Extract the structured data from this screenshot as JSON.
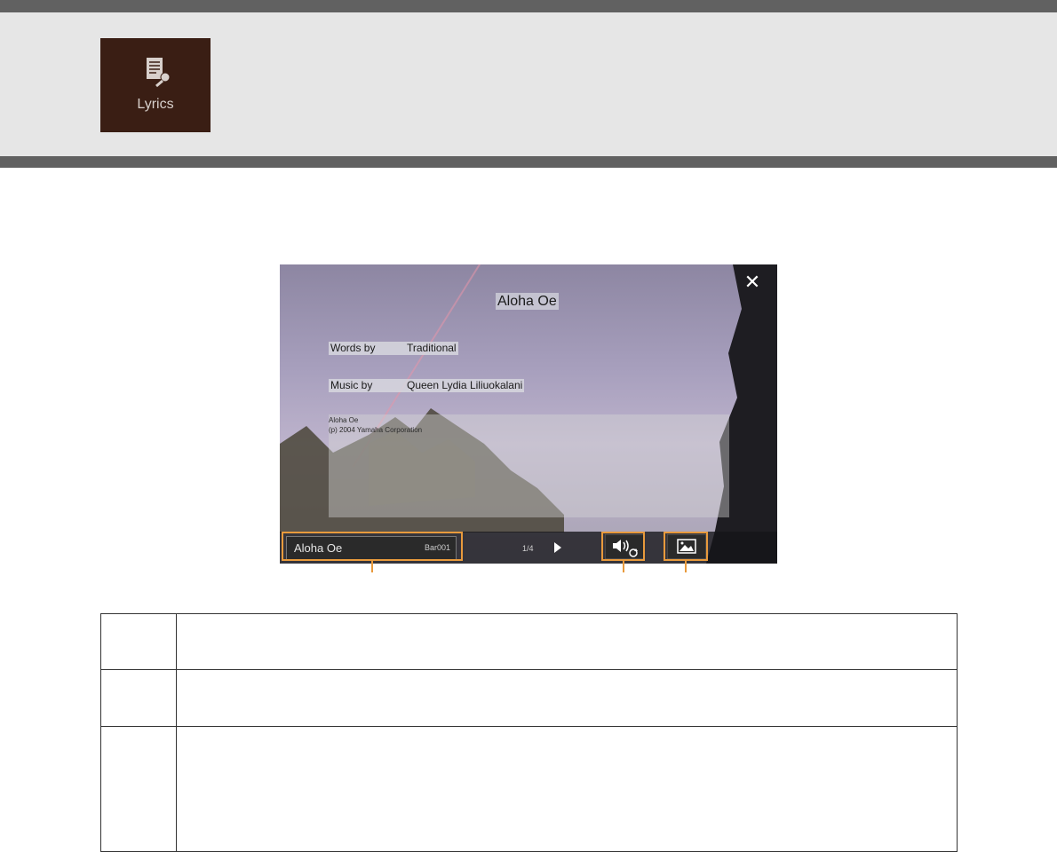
{
  "header": {
    "tile": {
      "label": "Lyrics",
      "icon": "lyrics-microphone-icon",
      "background": "#3a1e14"
    },
    "band_color": "#e6e6e6",
    "rule_color": "#616161"
  },
  "lyrics_screen": {
    "song_title": "Aloha Oe",
    "credits": [
      {
        "label": "Words by",
        "value": "Traditional"
      },
      {
        "label": "Music by",
        "value": "Queen Lydia Liliuokalani"
      }
    ],
    "info_lines": [
      "Aloha Oe",
      "(p) 2004 Yamaha Corporation"
    ],
    "close_icon": "close-icon",
    "bottom_bar": {
      "song_name": "Aloha Oe",
      "bar": "Bar001",
      "page": "1/4",
      "next_icon": "play-next-icon",
      "audio_icon": "audio-loop-icon",
      "image_icon": "image-icon"
    }
  },
  "callout_color": "#e89a3c",
  "description_table": {
    "rows": 3
  }
}
